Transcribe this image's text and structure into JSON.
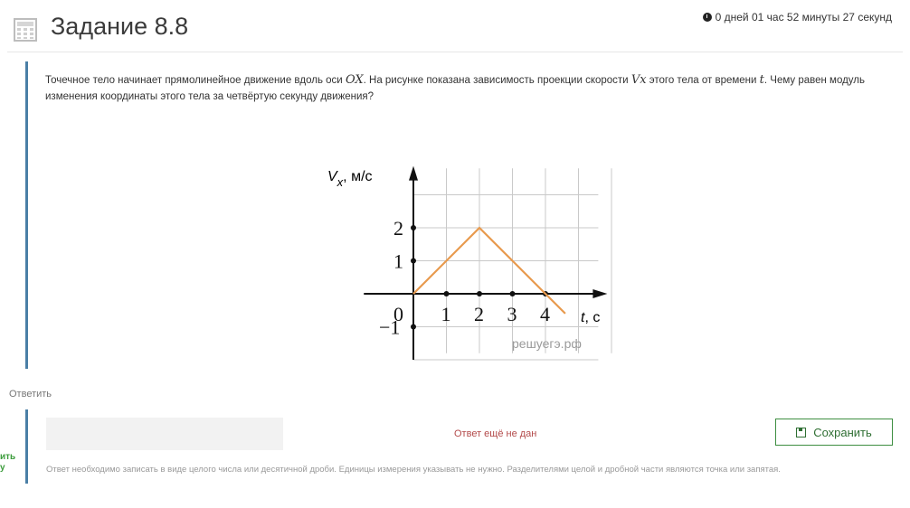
{
  "header": {
    "title": "Задание 8.8",
    "timer": "0 дней 01 час 52 минуты 27 секунд",
    "icon": "calculator-icon",
    "clock_icon": "clock-icon"
  },
  "question": {
    "text_parts": {
      "p1": "Точечное тело начинает прямолинейное движение вдоль оси ",
      "axis": "OX",
      "p2": ". На рисунке показана зависимость проекции скорости ",
      "vel": "Vx",
      "p3": " этого тела от времени ",
      "t": "t",
      "p4": ". Чему равен модуль изменения координаты этого тела за четвёртую секунду движения?"
    }
  },
  "chart_data": {
    "type": "line",
    "ylabel_main": "V",
    "ylabel_sub": "x",
    "ylabel_unit": ", м/с",
    "xlabel_main": "t",
    "xlabel_unit": ", с",
    "x_ticks": [
      "1",
      "2",
      "3",
      "4"
    ],
    "y_ticks": [
      "2",
      "1",
      "−1"
    ],
    "origin_label": "0",
    "xlim": [
      0,
      6
    ],
    "ylim": [
      -2,
      4
    ],
    "grid": true,
    "series": [
      {
        "x": [
          0,
          2,
          4,
          4.6
        ],
        "y": [
          0,
          2,
          0,
          -0.6
        ],
        "color": "#e89a4e"
      }
    ],
    "watermark": "решуегэ.рф"
  },
  "answer": {
    "label": "Ответить",
    "status": "Ответ ещё не дан",
    "save_label": "Сохранить",
    "hint": "Ответ необходимо записать в виде целого числа или десятичной дроби. Единицы измерения указывать не нужно. Разделителями целой и дробной части являются точка или запятая.",
    "side_cut_1": "ить",
    "side_cut_2": "у"
  }
}
